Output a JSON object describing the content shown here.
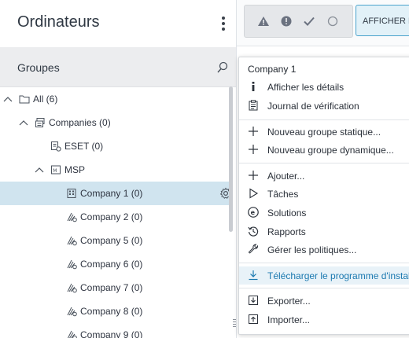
{
  "page": {
    "title": "Ordinateurs",
    "groups_label": "Groupes"
  },
  "toolbar": {
    "show_label": "AFFICHER LES"
  },
  "tree": [
    {
      "label": "All (6)",
      "toggle": "collapse",
      "icon": "folder-icon"
    },
    {
      "label": "Companies (0)",
      "toggle": "collapse",
      "icon": "static-group-icon"
    },
    {
      "label": "ESET (0)",
      "toggle": "",
      "icon": "dynamic-group-icon"
    },
    {
      "label": "MSP",
      "toggle": "collapse",
      "icon": "msp-icon"
    },
    {
      "label": "Company 1 (0)",
      "toggle": "",
      "icon": "company-building-icon",
      "selected": true
    },
    {
      "label": "Company 2 (0)",
      "toggle": "",
      "icon": "company-dynamic-icon"
    },
    {
      "label": "Company 5 (0)",
      "toggle": "",
      "icon": "company-dynamic-icon"
    },
    {
      "label": "Company 6 (0)",
      "toggle": "",
      "icon": "company-dynamic-icon"
    },
    {
      "label": "Company 7 (0)",
      "toggle": "",
      "icon": "company-dynamic-icon"
    },
    {
      "label": "Company 8 (0)",
      "toggle": "",
      "icon": "company-dynamic-icon"
    },
    {
      "label": "Company 9 (0)",
      "toggle": "",
      "icon": "company-dynamic-icon"
    }
  ],
  "context_menu": {
    "header": "Company 1",
    "items": [
      {
        "label": "Afficher les détails",
        "icon": "info-icon"
      },
      {
        "label": "Journal de vérification",
        "icon": "audit-log-icon"
      },
      {
        "label": "Nouveau groupe statique...",
        "icon": "plus-icon"
      },
      {
        "label": "Nouveau groupe dynamique...",
        "icon": "plus-icon"
      },
      {
        "label": "Ajouter...",
        "icon": "plus-icon"
      },
      {
        "label": "Tâches",
        "icon": "play-icon"
      },
      {
        "label": "Solutions",
        "icon": "eset-icon"
      },
      {
        "label": "Rapports",
        "icon": "history-icon"
      },
      {
        "label": "Gérer les politiques...",
        "icon": "wrench-icon"
      },
      {
        "label": "Télécharger le programme d'instal...",
        "icon": "download-icon",
        "highlighted": true
      },
      {
        "label": "Exporter...",
        "icon": "export-icon"
      },
      {
        "label": "Importer...",
        "icon": "import-icon"
      }
    ]
  },
  "colors": {
    "selection": "#d0e4ef",
    "accent": "#1b79b0",
    "groups_bar": "#ecedef"
  }
}
